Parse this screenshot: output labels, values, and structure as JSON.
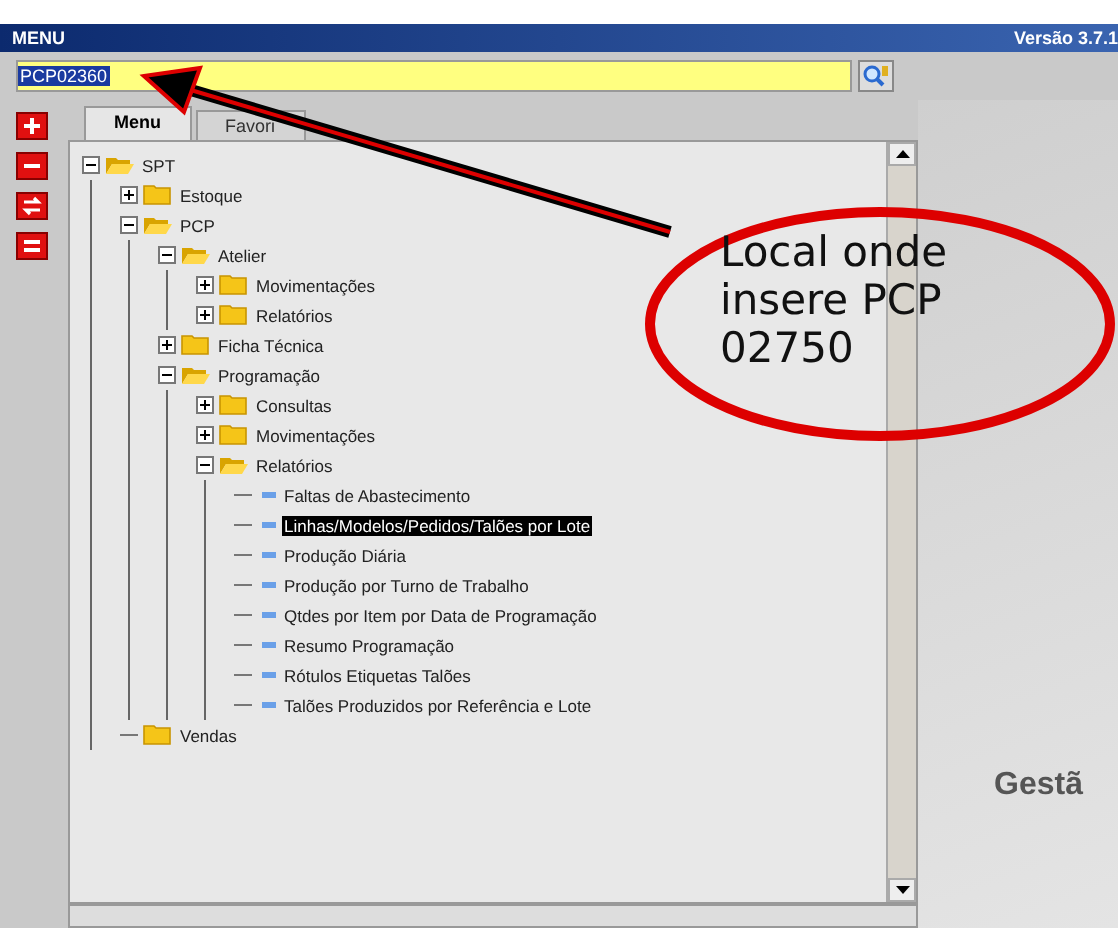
{
  "window": {
    "title": "MENU",
    "version": "Versão 3.7.1"
  },
  "command": {
    "value": "PCP02360"
  },
  "side_buttons": [
    {
      "kind": "plus"
    },
    {
      "kind": "minus"
    },
    {
      "kind": "swap"
    },
    {
      "kind": "equals"
    }
  ],
  "tabs": [
    {
      "label": "Menu",
      "selected": true
    },
    {
      "label": "Favori",
      "selected": false
    }
  ],
  "tree": [
    {
      "label": "SPT",
      "kind": "folder",
      "expanded": true,
      "children": [
        {
          "label": "Estoque",
          "kind": "folder",
          "expanded": false
        },
        {
          "label": "PCP",
          "kind": "folder",
          "expanded": true,
          "children": [
            {
              "label": "Atelier",
              "kind": "folder",
              "expanded": true,
              "children": [
                {
                  "label": "Movimentações",
                  "kind": "folder",
                  "expanded": false
                },
                {
                  "label": "Relatórios",
                  "kind": "folder",
                  "expanded": false
                }
              ]
            },
            {
              "label": "Ficha Técnica",
              "kind": "folder",
              "expanded": false
            },
            {
              "label": "Programação",
              "kind": "folder",
              "expanded": true,
              "children": [
                {
                  "label": "Consultas",
                  "kind": "folder",
                  "expanded": false
                },
                {
                  "label": "Movimentações",
                  "kind": "folder",
                  "expanded": false
                },
                {
                  "label": "Relatórios",
                  "kind": "folder",
                  "expanded": true,
                  "children": [
                    {
                      "label": "Faltas de Abastecimento",
                      "kind": "report",
                      "selected": false
                    },
                    {
                      "label": "Linhas/Modelos/Pedidos/Talões por Lote",
                      "kind": "report",
                      "selected": true
                    },
                    {
                      "label": "Produção Diária",
                      "kind": "report",
                      "selected": false
                    },
                    {
                      "label": "Produção por Turno de Trabalho",
                      "kind": "report",
                      "selected": false
                    },
                    {
                      "label": "Qtdes por Item por Data de Programação",
                      "kind": "report",
                      "selected": false
                    },
                    {
                      "label": "Resumo Programação",
                      "kind": "report",
                      "selected": false
                    },
                    {
                      "label": "Rótulos Etiquetas Talões",
                      "kind": "report",
                      "selected": false
                    },
                    {
                      "label": "Talões Produzidos por Referência e Lote",
                      "kind": "report",
                      "selected": false
                    }
                  ]
                }
              ]
            }
          ]
        },
        {
          "label": "Vendas",
          "kind": "folder"
        }
      ]
    }
  ],
  "right_panel": {
    "caption": "Gestã"
  },
  "annotation": {
    "lines": [
      "Local onde",
      "insere PCP",
      "02750"
    ]
  }
}
